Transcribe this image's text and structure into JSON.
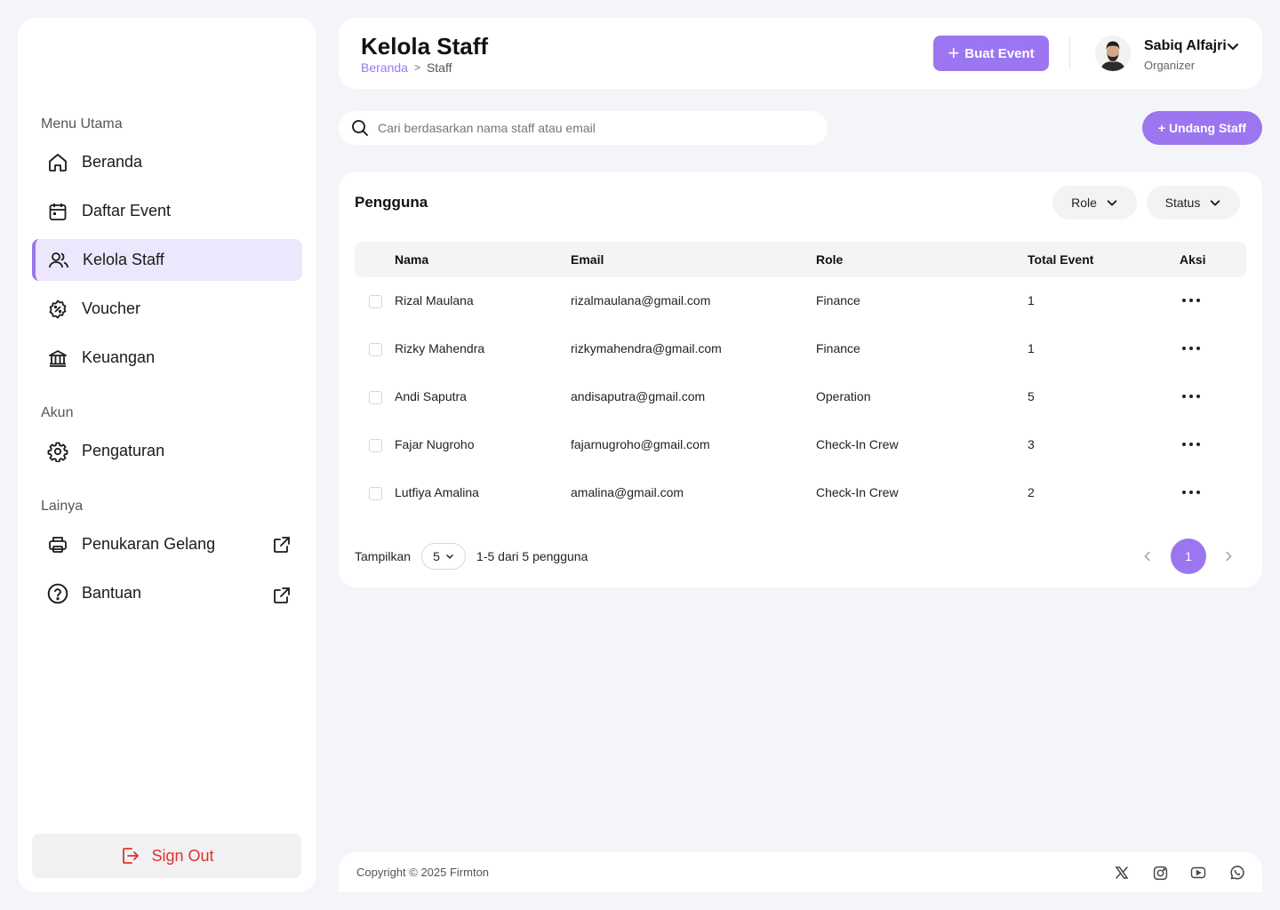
{
  "sidebar": {
    "sections": {
      "main": "Menu Utama",
      "account": "Akun",
      "other": "Lainya"
    },
    "items": [
      {
        "label": "Beranda",
        "icon": "home-icon"
      },
      {
        "label": "Daftar Event",
        "icon": "calendar-icon"
      },
      {
        "label": "Kelola Staff",
        "icon": "users-icon",
        "active": true
      },
      {
        "label": "Voucher",
        "icon": "voucher-icon"
      },
      {
        "label": "Keuangan",
        "icon": "bank-icon"
      },
      {
        "label": "Pengaturan",
        "icon": "gear-icon"
      },
      {
        "label": "Penukaran Gelang",
        "icon": "printer-icon",
        "external": true
      },
      {
        "label": "Bantuan",
        "icon": "help-icon",
        "external": true
      }
    ],
    "signout": "Sign Out"
  },
  "header": {
    "title": "Kelola Staff",
    "breadcrumb": {
      "home": "Beranda",
      "sep": ">",
      "current": "Staff"
    },
    "create_button": "Buat Event",
    "user": {
      "name": "Sabiq Alfajri",
      "role": "Organizer"
    }
  },
  "search": {
    "placeholder": "Cari berdasarkan nama staff atau email"
  },
  "invite_button": "+ Undang Staff",
  "table": {
    "title": "Pengguna",
    "filters": {
      "role": "Role",
      "status": "Status"
    },
    "columns": {
      "name": "Nama",
      "email": "Email",
      "role": "Role",
      "total": "Total Event",
      "action": "Aksi"
    },
    "rows": [
      {
        "name": "Rizal Maulana",
        "email": "rizalmaulana@gmail.com",
        "role": "Finance",
        "total": "1"
      },
      {
        "name": "Rizky Mahendra",
        "email": "rizkymahendra@gmail.com",
        "role": "Finance",
        "total": "1"
      },
      {
        "name": "Andi Saputra",
        "email": "andisaputra@gmail.com",
        "role": "Operation",
        "total": "5"
      },
      {
        "name": "Fajar Nugroho",
        "email": "fajarnugroho@gmail.com",
        "role": "Check-In Crew",
        "total": "3"
      },
      {
        "name": "Lutfiya Amalina",
        "email": "amalina@gmail.com",
        "role": "Check-In Crew",
        "total": "2"
      }
    ],
    "pagination": {
      "show_label": "Tampilkan",
      "per_page": "5",
      "summary": "1-5 dari 5 pengguna",
      "current_page": "1"
    }
  },
  "footer": {
    "copyright": "Copyright © 2025 Firmton",
    "social": [
      "x-icon",
      "instagram-icon",
      "youtube-icon",
      "whatsapp-icon"
    ]
  },
  "colors": {
    "accent": "#9b76f0",
    "accent_light": "#ece7fd",
    "danger": "#e0312a",
    "background": "#f4f5f9"
  }
}
